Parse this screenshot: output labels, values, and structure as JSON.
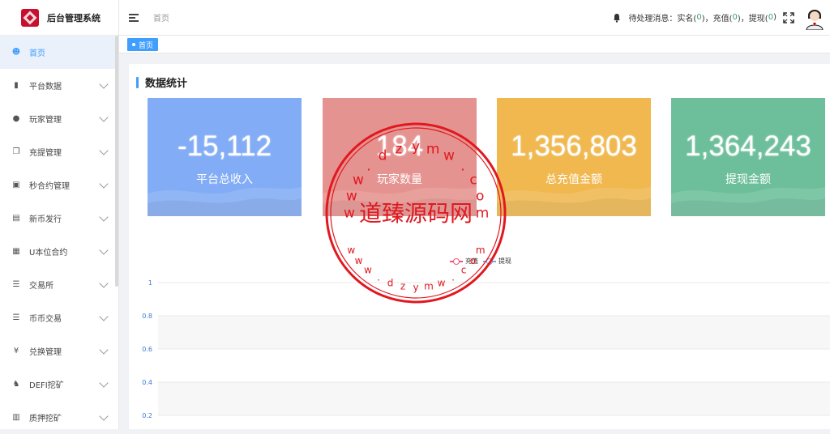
{
  "app": {
    "title": "后台管理系统"
  },
  "sidebar": {
    "items": [
      {
        "label": "首页",
        "icon": "dashboard-icon",
        "glyph": "☻",
        "active": true
      },
      {
        "label": "平台数据",
        "icon": "book-icon",
        "glyph": "▮"
      },
      {
        "label": "玩家管理",
        "icon": "user-icon",
        "glyph": "●"
      },
      {
        "label": "充提管理",
        "icon": "copy-icon",
        "glyph": "❐"
      },
      {
        "label": "秒合约管理",
        "icon": "monitor-icon",
        "glyph": "▣"
      },
      {
        "label": "新币发行",
        "icon": "ticket-icon",
        "glyph": "▤"
      },
      {
        "label": "U本位合约",
        "icon": "grid-icon",
        "glyph": "▦"
      },
      {
        "label": "交易所",
        "icon": "list-icon",
        "glyph": "☰"
      },
      {
        "label": "币币交易",
        "icon": "list-alt-icon",
        "glyph": "☰"
      },
      {
        "label": "兑换管理",
        "icon": "yen-icon",
        "glyph": "¥"
      },
      {
        "label": "DEFI挖矿",
        "icon": "person-walk-icon",
        "glyph": "♞"
      },
      {
        "label": "质押挖矿",
        "icon": "bar-chart-icon",
        "glyph": "▥"
      }
    ]
  },
  "header": {
    "breadcrumb": "首页",
    "notice_prefix": "待处理消息：实名(",
    "realname_count": "0",
    "recharge_prefix": ")，充值(",
    "recharge_count": "0",
    "withdraw_prefix": ")，提现(",
    "withdraw_count": "0",
    "notice_suffix": ")"
  },
  "tabs": [
    {
      "label": "首页"
    }
  ],
  "main": {
    "section_title": "数据统计",
    "cards": [
      {
        "value": "-15,112",
        "label": "平台总收入",
        "color": "#82acf5"
      },
      {
        "value": "184",
        "label": "玩家数量",
        "color": "#e59390"
      },
      {
        "value": "1,356,803",
        "label": "总充值金额",
        "color": "#f0b84f"
      },
      {
        "value": "1,364,243",
        "label": "提现金额",
        "color": "#6cbf9a"
      }
    ]
  },
  "chart_data": {
    "type": "line",
    "series": [
      {
        "name": "充值",
        "color": "#f2557a",
        "values": []
      },
      {
        "name": "提现",
        "color": "#7aa6e0",
        "values": []
      }
    ],
    "ylim": [
      0.2,
      1
    ],
    "yticks": [
      "1",
      "0.8",
      "0.6",
      "0.4",
      "0.2"
    ],
    "grid": true,
    "legend": "top-center"
  },
  "watermark": {
    "center_text": "道臻源码网",
    "top_letters": [
      "w",
      "w",
      "w",
      ".",
      "d",
      "z",
      "y",
      "m",
      "w",
      ".",
      "c",
      "o",
      "m"
    ],
    "bottom_letters": [
      "w",
      "w",
      "w",
      ".",
      "d",
      "z",
      "y",
      "m",
      "w",
      ".",
      "c",
      "o",
      "m"
    ],
    "color": "#e0181f"
  }
}
